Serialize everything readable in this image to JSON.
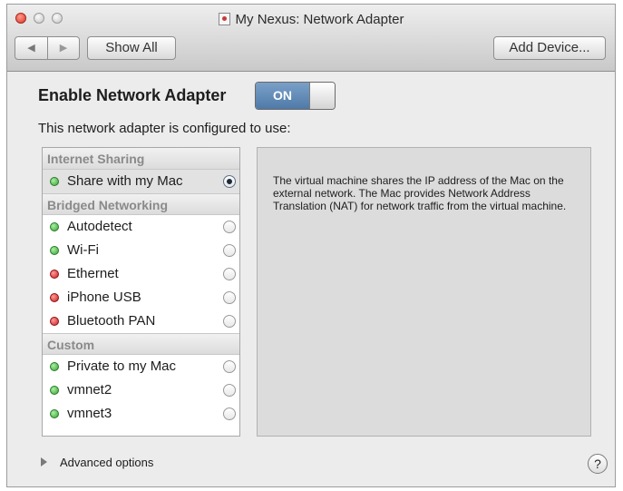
{
  "window": {
    "title": "My Nexus: Network Adapter"
  },
  "toolbar": {
    "back_glyph": "◀",
    "forward_glyph": "▶",
    "show_all_label": "Show All",
    "add_device_label": "Add Device..."
  },
  "main": {
    "heading": "Enable Network Adapter",
    "toggle_label": "ON",
    "toggle_state": true,
    "subheading": "This network adapter is configured to use:"
  },
  "network_list": {
    "groups": [
      {
        "label": "Internet Sharing",
        "items": [
          {
            "label": "Share with my Mac",
            "status": "green",
            "selected": true
          }
        ]
      },
      {
        "label": "Bridged Networking",
        "items": [
          {
            "label": "Autodetect",
            "status": "green",
            "selected": false
          },
          {
            "label": "Wi-Fi",
            "status": "green",
            "selected": false
          },
          {
            "label": "Ethernet",
            "status": "red",
            "selected": false
          },
          {
            "label": "iPhone USB",
            "status": "red",
            "selected": false
          },
          {
            "label": "Bluetooth PAN",
            "status": "red",
            "selected": false
          }
        ]
      },
      {
        "label": "Custom",
        "items": [
          {
            "label": "Private to my Mac",
            "status": "green",
            "selected": false
          },
          {
            "label": "vmnet2",
            "status": "green",
            "selected": false
          },
          {
            "label": "vmnet3",
            "status": "green",
            "selected": false
          }
        ]
      }
    ]
  },
  "info_panel": {
    "description": "The virtual machine shares the IP address of the Mac on the external network. The Mac provides Network Address Translation (NAT) for network traffic from the virtual machine."
  },
  "footer": {
    "advanced_label": "Advanced options",
    "help_glyph": "?"
  },
  "colors": {
    "status_green": "#3aa23a",
    "status_red": "#cc1e1e",
    "toggle_accent": "#4f7aa8"
  },
  "icons": {
    "title_icon": "vm-document-icon",
    "help_icon": "question-mark-icon",
    "disclosure_icon": "disclosure-triangle-icon"
  }
}
